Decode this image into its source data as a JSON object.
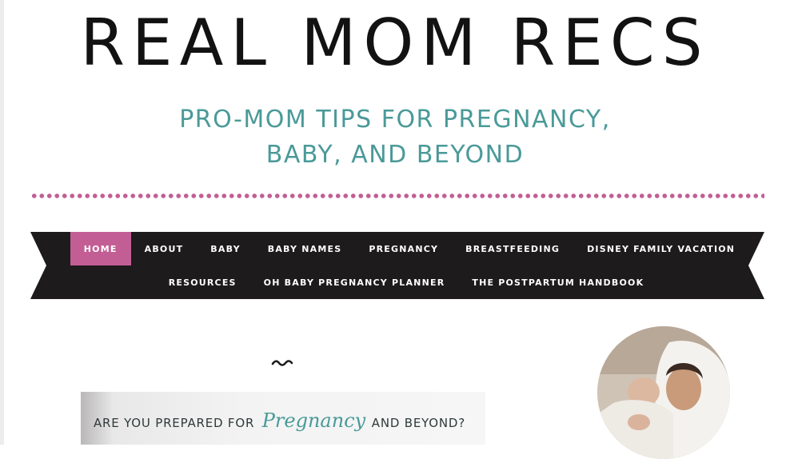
{
  "site": {
    "title": "REAL MOM RECS",
    "tagline_line1": "PRO-MOM TIPS FOR PREGNANCY,",
    "tagline_line2": "BABY, AND BEYOND"
  },
  "nav": {
    "row1": [
      "HOME",
      "ABOUT",
      "BABY",
      "BABY NAMES",
      "PREGNANCY",
      "BREASTFEEDING",
      "DISNEY FAMILY VACATION"
    ],
    "row2": [
      "RESOURCES",
      "OH BABY PREGNANCY PLANNER",
      "THE POSTPARTUM HANDBOOK"
    ],
    "active": "HOME"
  },
  "banner": {
    "text_before": "ARE YOU PREPARED FOR",
    "script_word": "Pregnancy",
    "text_after": "AND BEYOND?"
  },
  "colors": {
    "accent_pink": "#c35e95",
    "teal": "#4a9a98",
    "nav_bg": "#1d1b1c",
    "title": "#121212"
  },
  "icons": {
    "divider": "squiggle-divider-icon",
    "avatar": "author-photo"
  }
}
